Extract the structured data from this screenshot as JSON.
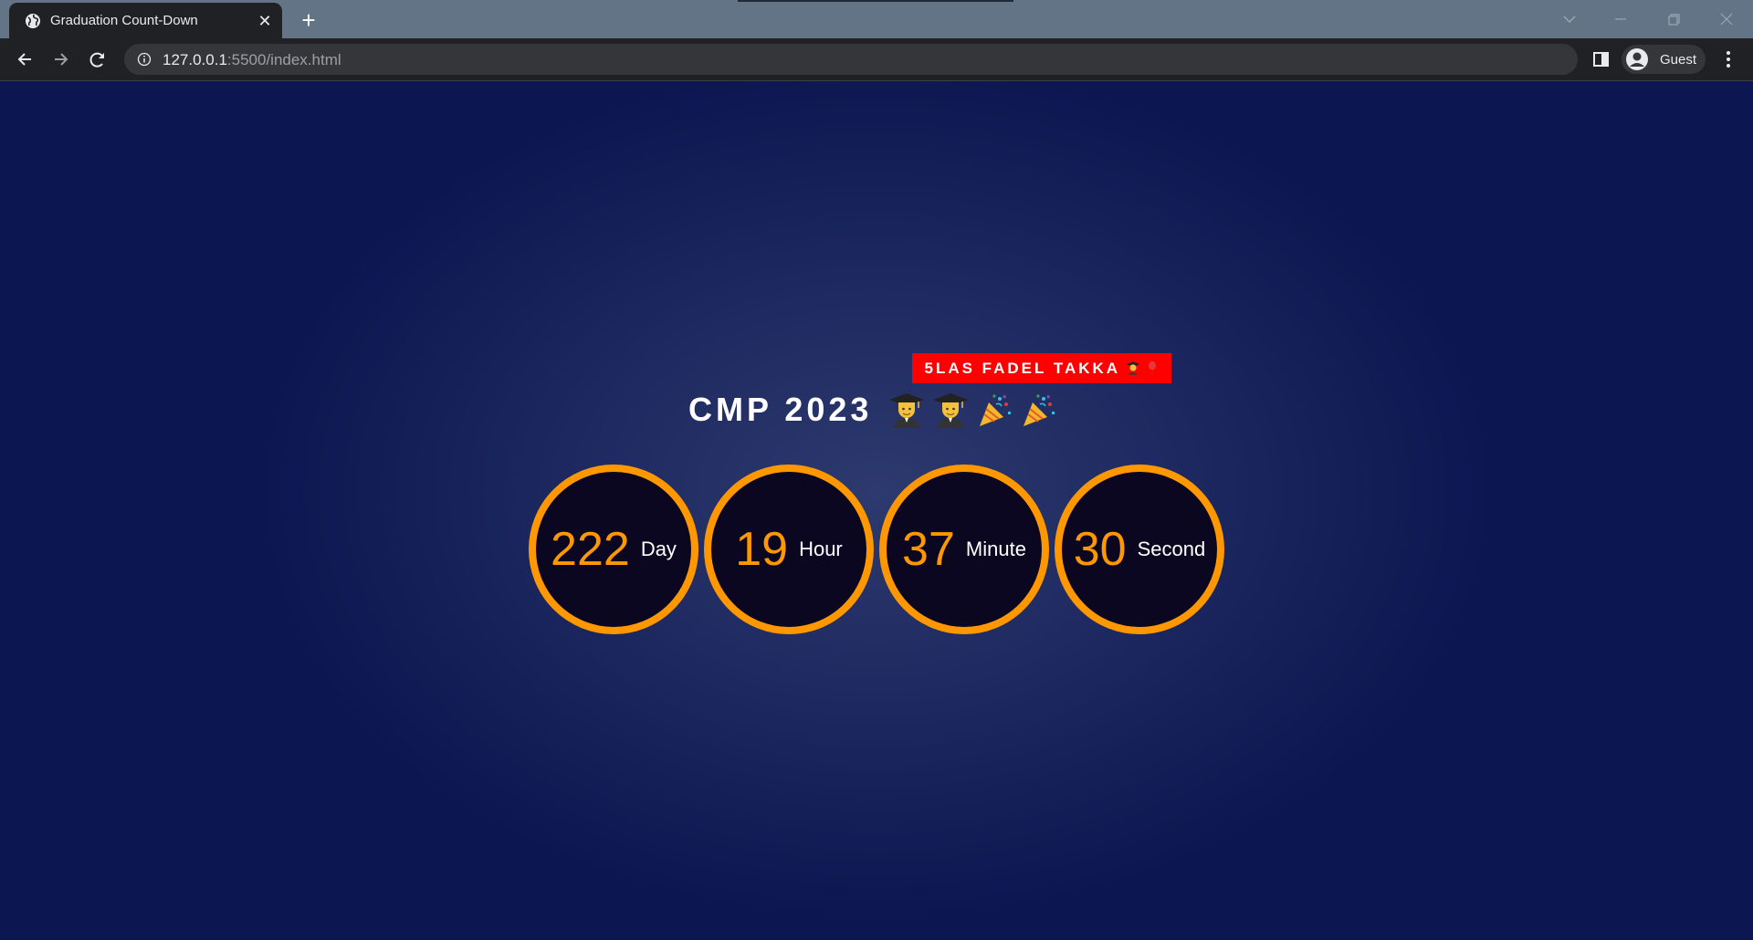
{
  "browser": {
    "tab_title": "Graduation Count-Down",
    "url_host": "127.0.0.1",
    "url_rest": ":5500/index.html",
    "profile_label": "Guest"
  },
  "page": {
    "banner_text": "5LAS FADEL TAKKA",
    "title": "CMP 2023",
    "title_icons": [
      "graduate-icon",
      "graduate-icon",
      "party-popper-icon",
      "party-popper-icon"
    ],
    "banner_icons": [
      "graduate-icon",
      "balloon-icon"
    ],
    "countdown": [
      {
        "value": "222",
        "unit": "Day"
      },
      {
        "value": "19",
        "unit": "Hour"
      },
      {
        "value": "37",
        "unit": "Minute"
      },
      {
        "value": "30",
        "unit": "Second"
      }
    ],
    "colors": {
      "accent": "#ff9800",
      "banner": "#ff0000",
      "circle_fill": "#0b0720",
      "background": "#0c1650"
    }
  }
}
